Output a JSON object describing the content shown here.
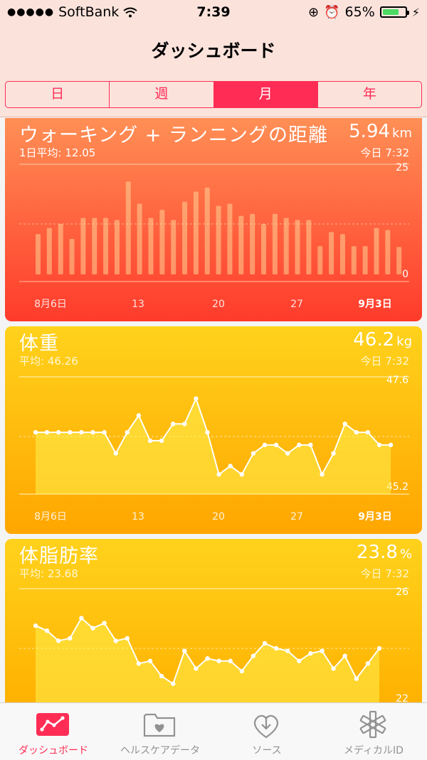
{
  "status": {
    "carrier": "SoftBank",
    "time": "7:39",
    "battery": "65%"
  },
  "nav": {
    "title": "ダッシュボード",
    "segments": [
      "日",
      "週",
      "月",
      "年"
    ],
    "active_segment": "月"
  },
  "cards": {
    "distance": {
      "title": "ウォーキング + ランニングの距離",
      "value": "5.94",
      "unit": "km",
      "sub": "1日平均: 12.05",
      "time": "今日 7:32"
    },
    "weight": {
      "title": "体重",
      "value": "46.2",
      "unit": "kg",
      "sub": "平均: 46.26",
      "time": "今日 7:32"
    },
    "bodyfat": {
      "title": "体脂肪率",
      "value": "23.8",
      "unit": "%",
      "sub": "平均: 23.68",
      "time": "今日 7:32"
    }
  },
  "chart_data": [
    {
      "type": "bar",
      "title": "ウォーキング + ランニングの距離",
      "x_ticks": [
        "8月6日",
        "13",
        "20",
        "27",
        "9月3日"
      ],
      "ylim": [
        0,
        25
      ],
      "y_ticks": [
        "25",
        "0"
      ],
      "values": [
        10,
        11.5,
        12.5,
        8.8,
        14,
        14,
        14,
        13.5,
        23,
        17.5,
        14,
        16,
        13.5,
        18,
        20.5,
        21.5,
        17,
        17.5,
        14.5,
        15,
        12.5,
        15,
        14,
        13.5,
        13.5,
        7,
        10.5,
        10,
        7,
        7,
        11.5,
        11,
        6.8
      ]
    },
    {
      "type": "line",
      "title": "体重",
      "x_ticks": [
        "8月6日",
        "13",
        "20",
        "27",
        "9月3日"
      ],
      "ylim": [
        45.2,
        47.6
      ],
      "y_ticks": [
        "47.6",
        "45.2"
      ],
      "values": [
        46.5,
        46.5,
        46.5,
        46.5,
        46.5,
        46.5,
        46.5,
        46.0,
        46.5,
        46.9,
        46.3,
        46.3,
        46.7,
        46.7,
        47.3,
        46.5,
        45.5,
        45.7,
        45.5,
        46.0,
        46.2,
        46.2,
        46.0,
        46.2,
        46.2,
        45.5,
        46.0,
        46.7,
        46.5,
        46.5,
        46.2,
        46.2
      ]
    },
    {
      "type": "line",
      "title": "体脂肪率",
      "ylim": [
        22,
        26
      ],
      "y_ticks": [
        "26",
        "22"
      ],
      "values": [
        24.9,
        24.7,
        24.3,
        24.4,
        25.2,
        24.8,
        25.0,
        24.3,
        24.4,
        23.4,
        23.5,
        22.9,
        22.6,
        23.9,
        23.2,
        23.6,
        23.5,
        23.5,
        23.1,
        23.7,
        24.2,
        24.0,
        23.9,
        23.5,
        23.8,
        23.9,
        23.2,
        23.7,
        22.8,
        23.4,
        24.0
      ]
    }
  ],
  "tabbar": {
    "items": [
      "ダッシュボード",
      "ヘルスケアデータ",
      "ソース",
      "メディカルID"
    ]
  }
}
